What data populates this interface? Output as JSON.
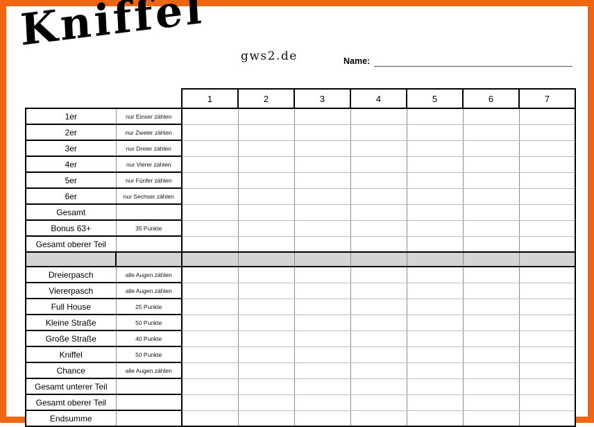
{
  "page": {
    "frame_color": "#ee6611",
    "background": "#ffffff",
    "separator_row_color": "#d4d4d4"
  },
  "header": {
    "title": "Kniffel",
    "site_tag": "gws2.de",
    "name_label": "Name:",
    "name_value": ""
  },
  "table": {
    "player_columns": [
      "1",
      "2",
      "3",
      "4",
      "5",
      "6",
      "7"
    ],
    "upper_section": [
      {
        "label": "1er",
        "desc": "nur Einser zählen"
      },
      {
        "label": "2er",
        "desc": "nur Zweier zählen"
      },
      {
        "label": "3er",
        "desc": "nur Dreier zählen"
      },
      {
        "label": "4er",
        "desc": "nur Vierer zählen"
      },
      {
        "label": "5er",
        "desc": "nur Fünfer zählen"
      },
      {
        "label": "6er",
        "desc": "nur Sechser zählen"
      },
      {
        "label": "Gesamt",
        "desc": ""
      },
      {
        "label": "Bonus 63+",
        "desc": "35 Punkte"
      },
      {
        "label": "Gesamt oberer Teil",
        "desc": ""
      }
    ],
    "lower_section": [
      {
        "label": "Dreierpasch",
        "desc": "alle Augen zählen"
      },
      {
        "label": "Viererpasch",
        "desc": "alle Augen zählen"
      },
      {
        "label": "Full House",
        "desc": "25 Punkte"
      },
      {
        "label": "Kleine Straße",
        "desc": "50 Punkte"
      },
      {
        "label": "Große Straße",
        "desc": "40 Punkte"
      },
      {
        "label": "Kniffel",
        "desc": "50 Punkte"
      },
      {
        "label": "Chance",
        "desc": "alle Augen zählen"
      },
      {
        "label": "Gesamt unterer Teil",
        "desc": ""
      },
      {
        "label": "Gesamt oberer Teil",
        "desc": ""
      },
      {
        "label": "Endsumme",
        "desc": ""
      }
    ]
  }
}
